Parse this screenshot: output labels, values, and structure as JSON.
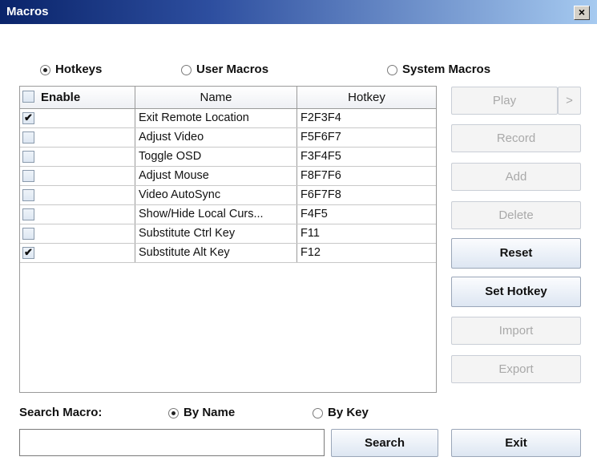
{
  "window": {
    "title": "Macros",
    "close_label": "×"
  },
  "mode": {
    "hotkeys": "Hotkeys",
    "user_macros": "User Macros",
    "system_macros": "System Macros",
    "selected": "hotkeys"
  },
  "table": {
    "headers": {
      "enable": "Enable",
      "name": "Name",
      "hotkey": "Hotkey"
    },
    "rows": [
      {
        "enabled": true,
        "name": "Exit Remote Location",
        "hotkey": "F2F3F4"
      },
      {
        "enabled": false,
        "name": "Adjust Video",
        "hotkey": "F5F6F7"
      },
      {
        "enabled": false,
        "name": "Toggle OSD",
        "hotkey": "F3F4F5"
      },
      {
        "enabled": false,
        "name": "Adjust Mouse",
        "hotkey": "F8F7F6"
      },
      {
        "enabled": false,
        "name": "Video AutoSync",
        "hotkey": "F6F7F8"
      },
      {
        "enabled": false,
        "name": "Show/Hide Local Curs...",
        "hotkey": "F4F5"
      },
      {
        "enabled": false,
        "name": "Substitute Ctrl Key",
        "hotkey": "F11"
      },
      {
        "enabled": true,
        "name": "Substitute Alt Key",
        "hotkey": "F12"
      }
    ]
  },
  "buttons": {
    "play": "Play",
    "play_more": ">",
    "record": "Record",
    "add": "Add",
    "delete": "Delete",
    "reset": "Reset",
    "set_hotkey": "Set Hotkey",
    "import": "Import",
    "export": "Export",
    "search": "Search",
    "exit": "Exit"
  },
  "search": {
    "label": "Search Macro:",
    "by_name": "By Name",
    "by_key": "By Key",
    "selected": "by_name",
    "value": ""
  },
  "colors": {
    "title_bar_start": "#0a246a",
    "title_bar_end": "#a6caf0"
  }
}
